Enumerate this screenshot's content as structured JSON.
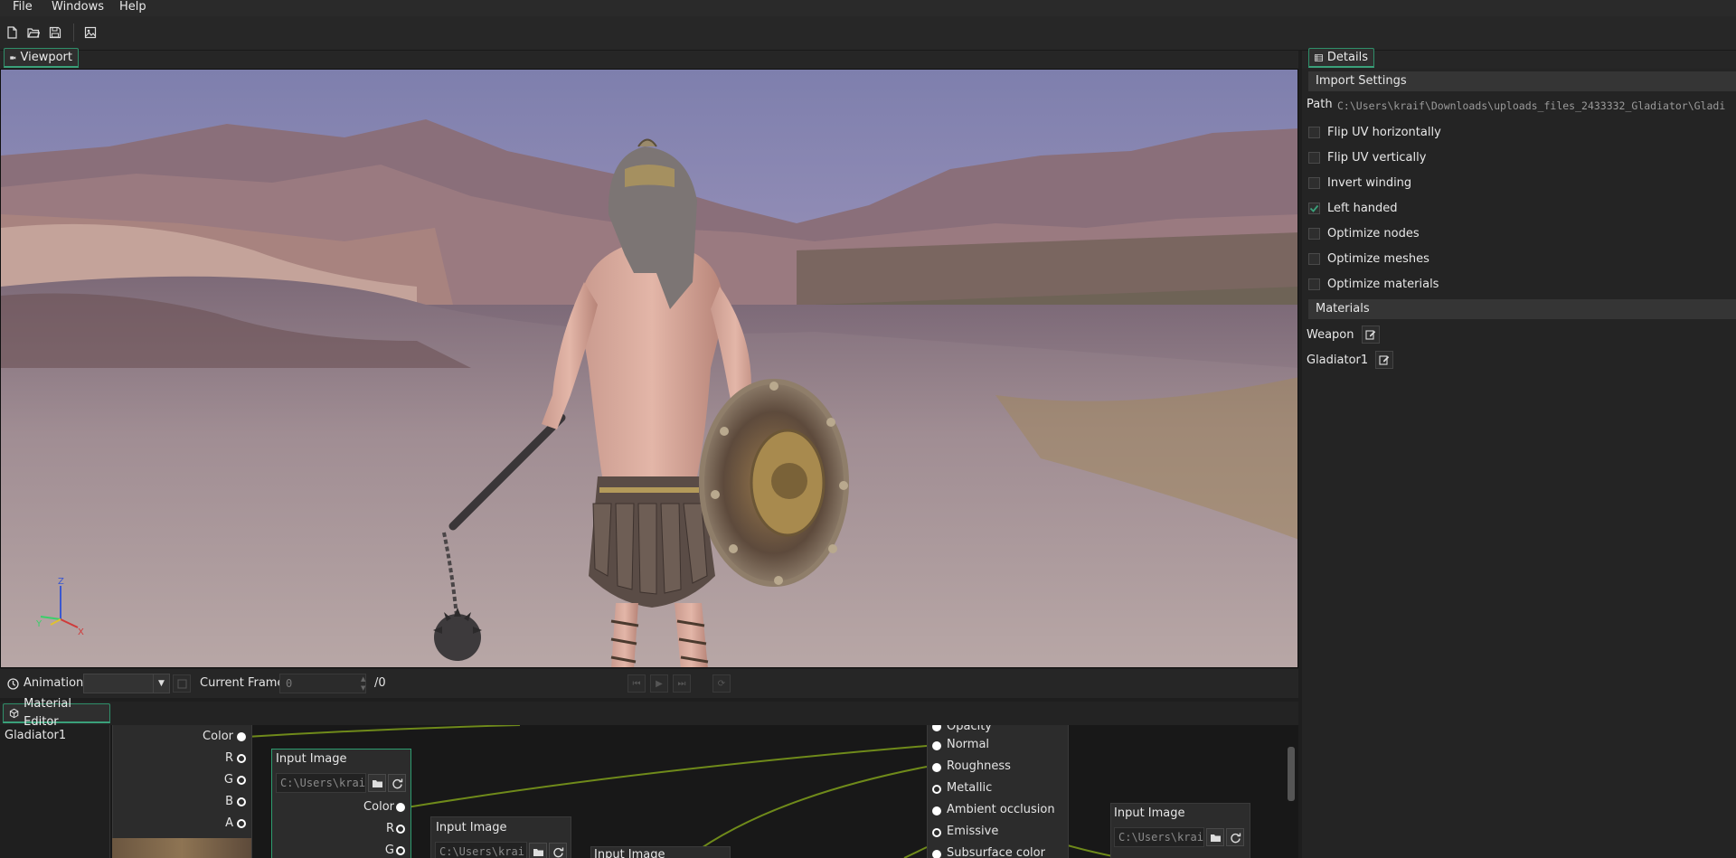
{
  "menu": [
    "File",
    "Windows",
    "Help"
  ],
  "toolbar": {
    "icons": [
      "new-file-icon",
      "open-folder-icon",
      "save-icon",
      "import-image-icon"
    ]
  },
  "viewport": {
    "tab_label": "Viewport",
    "axis_labels": {
      "z": "Z",
      "y": "Y",
      "x": "X"
    }
  },
  "animation": {
    "label": "Animation:",
    "selected": "",
    "current_frame_label": "Current Frame:",
    "frame_value": "0",
    "frame_total": "/0"
  },
  "details": {
    "tab_label": "Details",
    "import_settings_header": "Import Settings",
    "path_label": "Path",
    "path_value": "C:\\Users\\kraif\\Downloads\\uploads_files_2433332_Gladiator\\Gladi",
    "options": [
      {
        "label": "Flip UV horizontally",
        "checked": false
      },
      {
        "label": "Flip UV vertically",
        "checked": false
      },
      {
        "label": "Invert winding",
        "checked": false
      },
      {
        "label": "Left handed",
        "checked": true
      },
      {
        "label": "Optimize nodes",
        "checked": false
      },
      {
        "label": "Optimize meshes",
        "checked": false
      },
      {
        "label": "Optimize materials",
        "checked": false
      }
    ],
    "materials_header": "Materials",
    "materials": [
      "Weapon",
      "Gladiator1"
    ]
  },
  "material_editor": {
    "tab_label": "Material Editor",
    "list": [
      "Gladiator1"
    ],
    "left_node_pins": [
      "Color",
      "R",
      "G",
      "B",
      "A"
    ],
    "input_image_title": "Input Image",
    "input_image_path": "C:\\Users\\krai",
    "node1_pins": [
      "Color",
      "R",
      "G"
    ],
    "node3_title": "Input Image",
    "output_inputs": [
      "Opacity",
      "Normal",
      "Roughness",
      "Metallic",
      "Ambient occlusion",
      "Emissive",
      "Subsurface color"
    ],
    "right_node_title": "Input Image",
    "right_node_path": "C:\\Users\\krai"
  },
  "colors": {
    "accent": "#2e9c6f",
    "wire": "#6f8a1a"
  }
}
